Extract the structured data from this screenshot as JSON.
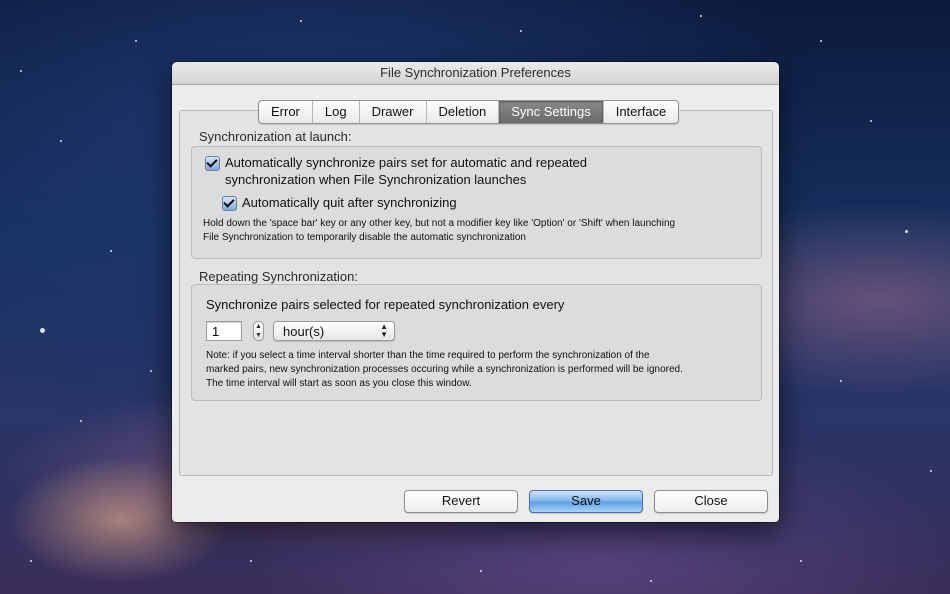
{
  "window": {
    "title": "File Synchronization Preferences"
  },
  "tabs": [
    {
      "label": "Error"
    },
    {
      "label": "Log"
    },
    {
      "label": "Drawer"
    },
    {
      "label": "Deletion"
    },
    {
      "label": "Sync Settings",
      "active": true
    },
    {
      "label": "Interface"
    }
  ],
  "launch": {
    "section_label": "Synchronization at launch:",
    "auto_sync_line1": "Automatically synchronize pairs set for automatic and repeated",
    "auto_sync_line2": "synchronization when File Synchronization launches",
    "auto_sync_checked": true,
    "auto_quit": "Automatically quit after synchronizing",
    "auto_quit_checked": true,
    "note_line1": "Hold down the 'space bar' key or any other key, but not a modifier key like 'Option' or 'Shift' when launching",
    "note_line2": "File Synchronization to temporarily disable the automatic synchronization"
  },
  "repeating": {
    "section_label": "Repeating Synchronization:",
    "description": "Synchronize pairs selected for repeated synchronization every",
    "interval_value": "1",
    "interval_unit": "hour(s)",
    "note_line1": "Note: if you select a time interval shorter than the time required to perform the synchronization of the",
    "note_line2": "marked pairs, new synchronization processes occuring while a synchronization is performed will be ignored.",
    "note_line3": "The time interval will start as soon as you close this window."
  },
  "buttons": {
    "revert": "Revert",
    "save": "Save",
    "close": "Close"
  },
  "colors": {
    "accent": "#5d9ce3",
    "active_tab": "#6a6a6a",
    "window_bg": "#ececec"
  }
}
